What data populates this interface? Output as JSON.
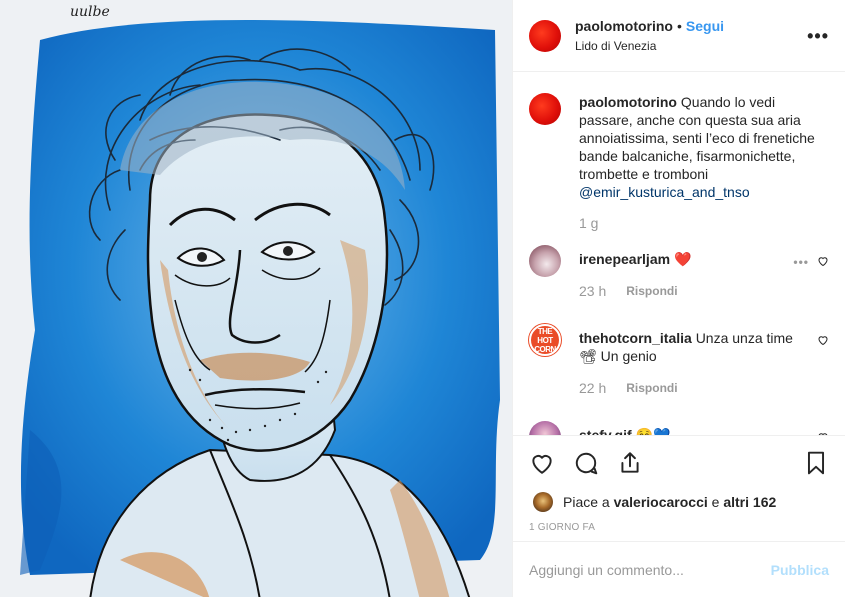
{
  "post": {
    "image_alt": "Watercolor portrait illustration",
    "signature": "uulbe"
  },
  "header": {
    "username": "paolomotorino",
    "separator": "•",
    "follow_label": "Segui",
    "location": "Lido di Venezia",
    "more_label": "•••"
  },
  "caption": {
    "username": "paolomotorino",
    "text": "Quando lo vedi passare, anche con questa sua aria annoiatissima, senti l’eco di frenetiche bande balcaniche, fisarmonichette, trombette e tromboni",
    "mention": "@emir_kusturica_and_tnso",
    "time": "1 g"
  },
  "comments": [
    {
      "username": "irenepearljam",
      "text": "❤️",
      "time": "23 h",
      "reply_label": "Rispondi",
      "more_label": "•••"
    },
    {
      "username": "thehotcorn_italia",
      "text": "Unza unza time 📽 Un genio",
      "time": "22 h",
      "reply_label": "Rispondi",
      "avatar_text": "THE HOT CORN"
    },
    {
      "username": "stefy.gif",
      "text": "☺️💙"
    }
  ],
  "actions": {
    "likes_prefix": "Piace a",
    "liked_by": "valeriocarocci",
    "likes_suffix_and": "e",
    "likes_others": "altri 162",
    "time_ago": "1 giorno fa"
  },
  "add_comment": {
    "placeholder": "Aggiungi un commento...",
    "post_label": "Pubblica"
  },
  "colors": {
    "link_blue": "#3897f0",
    "mention_blue": "#003569",
    "muted_gray": "#999999",
    "post_disabled": "#b2dffc",
    "avatar_red": "#e0100a",
    "art_blue": "#1f86d6"
  }
}
